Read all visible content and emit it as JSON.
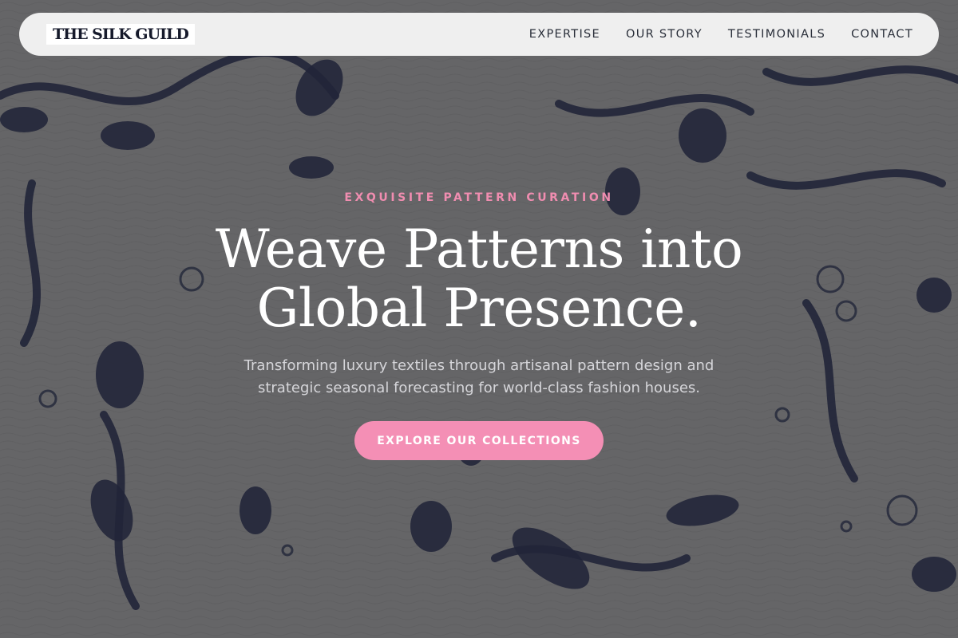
{
  "brand": {
    "logo_text": "THE SILK GUILD"
  },
  "nav": {
    "items": [
      {
        "label": "EXPERTISE"
      },
      {
        "label": "OUR STORY"
      },
      {
        "label": "TESTIMONIALS"
      },
      {
        "label": "CONTACT"
      }
    ]
  },
  "hero": {
    "eyebrow": "EXQUISITE PATTERN CURATION",
    "headline_line1": "Weave Patterns into",
    "headline_line2": "Global Presence.",
    "subtitle": "Transforming luxury textiles through artisanal pattern design and strategic seasonal forecasting for world-class fashion houses.",
    "cta_label": "EXPLORE OUR COLLECTIONS",
    "background_image": "batik-floral-textile-pattern"
  },
  "colors": {
    "accent_pink": "#f48fb5",
    "eyebrow_pink": "#f08db0",
    "navbar_bg": "#efefef",
    "pattern_ink": "#1e2440",
    "fabric_gray": "#8e8e8e"
  }
}
